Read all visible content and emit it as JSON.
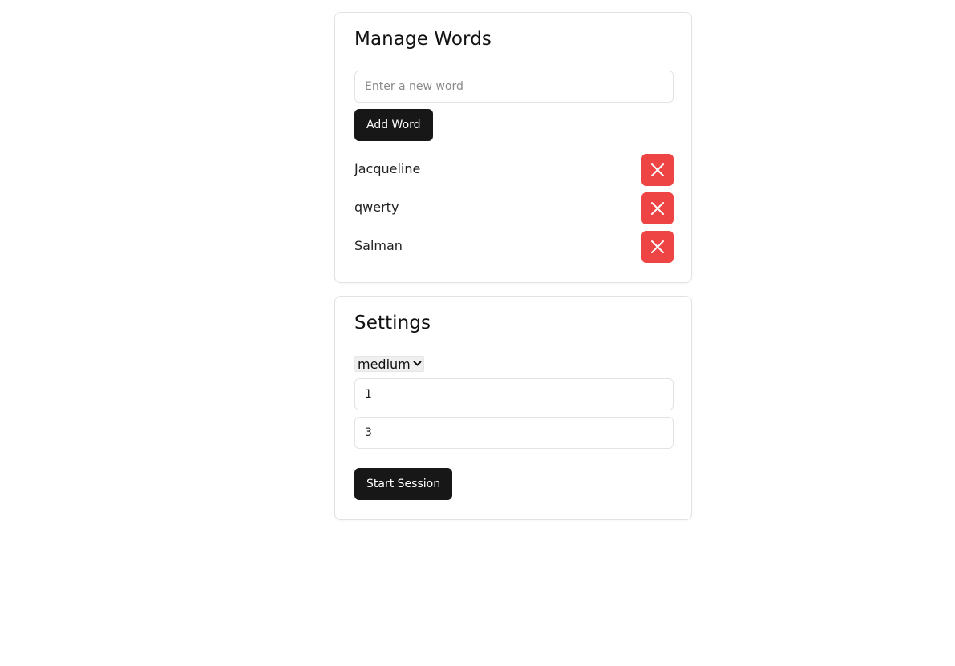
{
  "manage_words": {
    "title": "Manage Words",
    "input": {
      "value": "",
      "placeholder": "Enter a new word"
    },
    "add_button_label": "Add Word",
    "words": [
      {
        "label": "Jacqueline",
        "delete_icon": "close-icon"
      },
      {
        "label": "qwerty",
        "delete_icon": "close-icon"
      },
      {
        "label": "Salman",
        "delete_icon": "close-icon"
      }
    ]
  },
  "settings": {
    "title": "Settings",
    "difficulty_select": {
      "selected": "medium",
      "icon": "chevron-down-icon"
    },
    "field_1_value": "1",
    "field_2_value": "3",
    "start_button_label": "Start Session"
  },
  "colors": {
    "primary_button": "#171717",
    "delete_button": "#ef4444",
    "card_border": "#e2e2e2"
  }
}
